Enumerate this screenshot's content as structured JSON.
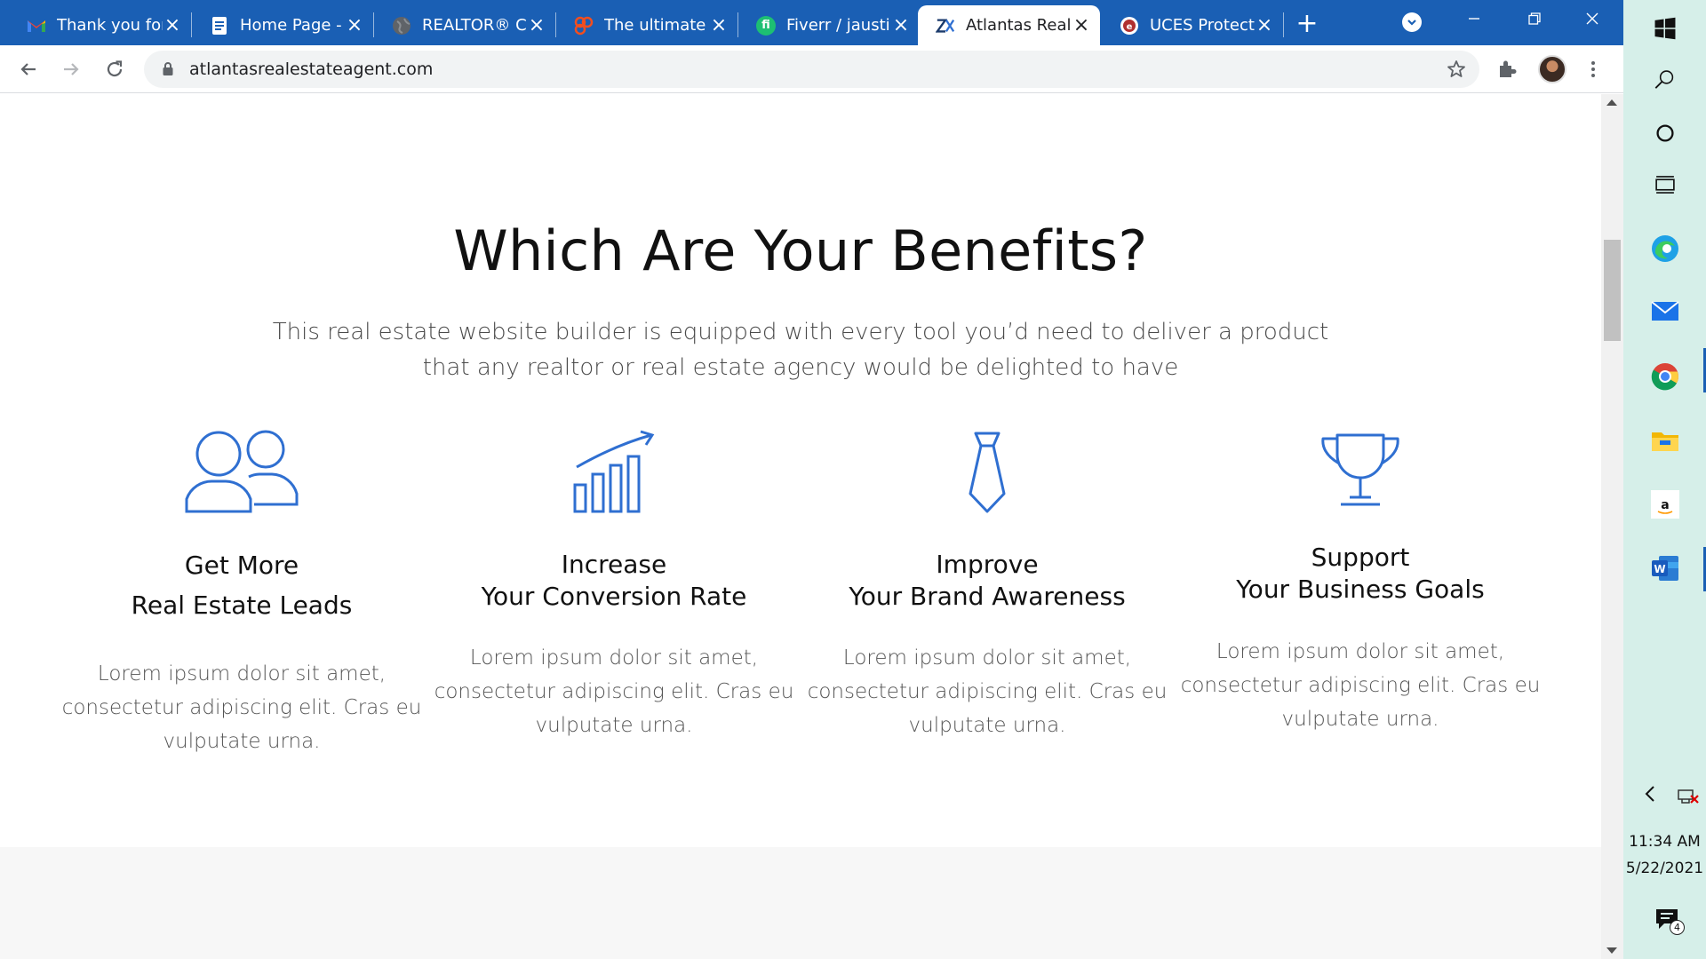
{
  "tabs": [
    {
      "title": "Thank you for",
      "favicon": "gmail-icon",
      "color": "#ea4335"
    },
    {
      "title": "Home Page -",
      "favicon": "document-icon",
      "color": "#ffffff"
    },
    {
      "title": "REALTOR® Co",
      "favicon": "globe-icon",
      "color": "#5f6368"
    },
    {
      "title": "The ultimate l",
      "favicon": "brand-icon",
      "color": "#f24e1e"
    },
    {
      "title": "Fiverr / jaustin",
      "favicon": "fiverr-icon",
      "color": "#1dbf73"
    },
    {
      "title": "Atlantas Real",
      "favicon": "atlantas-icon",
      "color": "#1a3a6b"
    },
    {
      "title": "UCES Protecti",
      "favicon": "uces-icon",
      "color": "#b03030"
    }
  ],
  "toolbar": {
    "url": "atlantasrealestateagent.com"
  },
  "page": {
    "heading": "Which Are Your Benefits?",
    "subtitle": "This real estate website builder is equipped with every tool you’d need to deliver a product that any realtor or real estate agency would be delighted to have",
    "accent_color": "#2f6fd1",
    "benefits": [
      {
        "title_line1": "Get More",
        "title_line2": "Real Estate Leads",
        "icon": "people-icon",
        "text": "Lorem ipsum dolor sit amet, consectetur adipiscing elit. Cras eu vulputate urna."
      },
      {
        "title_line1": "Increase",
        "title_line2": "Your Conversion Rate",
        "icon": "growth-chart-icon",
        "text": "Lorem ipsum dolor sit amet, consectetur adipiscing elit. Cras eu vulputate urna."
      },
      {
        "title_line1": "Improve",
        "title_line2": "Your Brand Awareness",
        "icon": "tie-icon",
        "text": "Lorem ipsum dolor sit amet, consectetur adipiscing elit. Cras eu vulputate urna."
      },
      {
        "title_line1": "Support",
        "title_line2": "Your Business Goals",
        "icon": "trophy-icon",
        "text": "Lorem ipsum dolor sit amet, consectetur adipiscing elit. Cras eu vulputate urna."
      }
    ]
  },
  "taskbar": {
    "apps": [
      "windows-start-icon",
      "search-icon",
      "cortana-icon",
      "task-view-icon",
      "edge-icon",
      "mail-icon",
      "chrome-icon",
      "file-explorer-icon",
      "amazon-icon",
      "word-icon"
    ],
    "amazon_glyph": "a",
    "word_glyph": "W",
    "time": "11:34 AM",
    "date": "5/22/2021",
    "notification_count": "4"
  }
}
